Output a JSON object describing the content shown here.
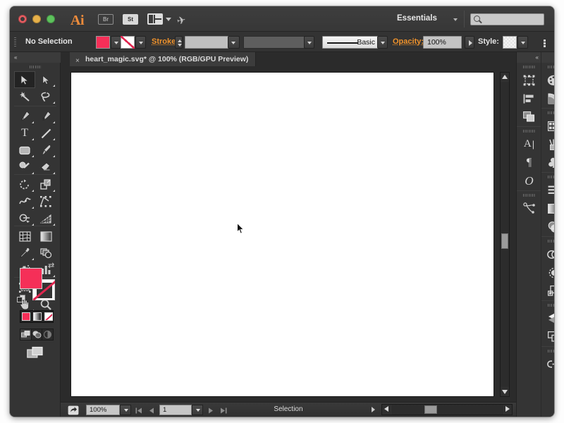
{
  "app": {
    "name": "Adobe Illustrator",
    "logo_text": "Ai",
    "bridge_label": "Br",
    "stock_label": "St",
    "workspace": "Essentials",
    "search_placeholder": ""
  },
  "titlebar": {
    "close_tooltip": "Close",
    "minimize_tooltip": "Minimize",
    "zoom_tooltip": "Zoom"
  },
  "control_bar": {
    "selection_state": "No Selection",
    "fill_color": "#f52f58",
    "stroke_color": "none",
    "stroke_label": "Stroke:",
    "stroke_weight": "",
    "stroke_profile": "",
    "brush_definition": "Basic",
    "opacity_label": "Opacity:",
    "opacity_value": "100%",
    "style_label": "Style:",
    "menu_tooltip": "Panel Menu"
  },
  "document_tab": {
    "title": "heart_magic.svg* @ 100% (RGB/GPU Preview)",
    "close_glyph": "×"
  },
  "toolbar": {
    "collapse_glyph": "«",
    "tools": [
      {
        "name": "selection-tool",
        "label": "Selection",
        "selected": true,
        "has_flyout": false
      },
      {
        "name": "direct-selection-tool",
        "label": "Direct Selection",
        "selected": false,
        "has_flyout": true
      },
      {
        "name": "magic-wand-tool",
        "label": "Magic Wand",
        "selected": false,
        "has_flyout": false
      },
      {
        "name": "lasso-tool",
        "label": "Lasso",
        "selected": false,
        "has_flyout": false
      },
      {
        "name": "pen-tool",
        "label": "Pen",
        "selected": false,
        "has_flyout": true
      },
      {
        "name": "curvature-tool",
        "label": "Curvature",
        "selected": false,
        "has_flyout": false
      },
      {
        "name": "type-tool",
        "label": "Type",
        "selected": false,
        "has_flyout": true
      },
      {
        "name": "line-segment-tool",
        "label": "Line Segment",
        "selected": false,
        "has_flyout": true
      },
      {
        "name": "rectangle-tool",
        "label": "Rectangle",
        "selected": false,
        "has_flyout": true
      },
      {
        "name": "paintbrush-tool",
        "label": "Paintbrush",
        "selected": false,
        "has_flyout": true
      },
      {
        "name": "shaper-tool",
        "label": "Shaper",
        "selected": false,
        "has_flyout": true
      },
      {
        "name": "eraser-tool",
        "label": "Eraser",
        "selected": false,
        "has_flyout": true
      },
      {
        "name": "rotate-tool",
        "label": "Rotate",
        "selected": false,
        "has_flyout": true
      },
      {
        "name": "scale-tool",
        "label": "Scale",
        "selected": false,
        "has_flyout": true
      },
      {
        "name": "width-tool",
        "label": "Width",
        "selected": false,
        "has_flyout": true
      },
      {
        "name": "free-transform-tool",
        "label": "Free Transform",
        "selected": false,
        "has_flyout": false
      },
      {
        "name": "shape-builder-tool",
        "label": "Shape Builder",
        "selected": false,
        "has_flyout": true
      },
      {
        "name": "perspective-grid-tool",
        "label": "Perspective Grid",
        "selected": false,
        "has_flyout": true
      },
      {
        "name": "mesh-tool",
        "label": "Mesh",
        "selected": false,
        "has_flyout": false
      },
      {
        "name": "gradient-tool",
        "label": "Gradient",
        "selected": false,
        "has_flyout": false
      },
      {
        "name": "eyedropper-tool",
        "label": "Eyedropper",
        "selected": false,
        "has_flyout": true
      },
      {
        "name": "blend-tool",
        "label": "Blend",
        "selected": false,
        "has_flyout": false
      },
      {
        "name": "symbol-sprayer-tool",
        "label": "Symbol Sprayer",
        "selected": false,
        "has_flyout": true
      },
      {
        "name": "column-graph-tool",
        "label": "Column Graph",
        "selected": false,
        "has_flyout": true
      },
      {
        "name": "artboard-tool",
        "label": "Artboard",
        "selected": false,
        "has_flyout": false
      },
      {
        "name": "slice-tool",
        "label": "Slice",
        "selected": false,
        "has_flyout": true
      },
      {
        "name": "hand-tool",
        "label": "Hand",
        "selected": false,
        "has_flyout": true
      },
      {
        "name": "zoom-tool",
        "label": "Zoom",
        "selected": false,
        "has_flyout": false
      }
    ],
    "fill_stroke": {
      "fill_color": "#f52f58",
      "stroke_color": "none",
      "swap_tooltip": "Swap Fill and Stroke",
      "default_tooltip": "Default Fill and Stroke"
    },
    "fill_modes": [
      {
        "name": "color-mode",
        "label": "Color",
        "active": true
      },
      {
        "name": "gradient-mode",
        "label": "Gradient",
        "active": false
      },
      {
        "name": "none-mode",
        "label": "None",
        "active": false
      }
    ],
    "draw_modes": [
      {
        "name": "draw-normal-mode",
        "label": "Draw Normal",
        "active": true
      },
      {
        "name": "draw-behind-mode",
        "label": "Draw Behind",
        "active": false
      },
      {
        "name": "draw-inside-mode",
        "label": "Draw Inside",
        "active": false
      }
    ],
    "screen_mode": {
      "name": "change-screen-mode",
      "label": "Change Screen Mode"
    }
  },
  "right_dock_a": {
    "collapse_glyph": "«",
    "panels": [
      {
        "name": "transform-panel",
        "label": "Transform"
      },
      {
        "name": "align-panel",
        "label": "Align"
      },
      {
        "name": "pathfinder-panel",
        "label": "Pathfinder"
      },
      {
        "name": "character-panel",
        "label": "Character"
      },
      {
        "name": "paragraph-panel",
        "label": "Paragraph"
      },
      {
        "name": "opentype-panel",
        "label": "OpenType"
      },
      {
        "name": "image-trace-panel",
        "label": "Image Trace"
      }
    ]
  },
  "right_dock_b": {
    "collapse_glyph": "«",
    "panels": [
      {
        "name": "color-panel",
        "label": "Color"
      },
      {
        "name": "color-guide-panel",
        "label": "Color Guide"
      },
      {
        "name": "swatches-panel",
        "label": "Swatches"
      },
      {
        "name": "brushes-panel",
        "label": "Brushes"
      },
      {
        "name": "symbols-panel",
        "label": "Symbols"
      },
      {
        "name": "stroke-panel",
        "label": "Stroke"
      },
      {
        "name": "gradient-panel",
        "label": "Gradient"
      },
      {
        "name": "transparency-panel",
        "label": "Transparency"
      },
      {
        "name": "appearance-panel",
        "label": "Appearance"
      },
      {
        "name": "graphic-styles-panel",
        "label": "Graphic Styles"
      },
      {
        "name": "artboards-panel",
        "label": "Artboards"
      },
      {
        "name": "layers-panel",
        "label": "Layers"
      },
      {
        "name": "artboards2-panel",
        "label": "Artboards"
      },
      {
        "name": "links-panel",
        "label": "Links"
      }
    ]
  },
  "status_bar": {
    "export_tooltip": "Export",
    "zoom_level": "100%",
    "page_number": "1",
    "status_text": "Selection",
    "first_glyph": "⏮",
    "prev_glyph": "◀",
    "next_glyph": "▶",
    "last_glyph": "⏭"
  },
  "canvas": {
    "background_color": "#2b2b2b",
    "artboard_color": "#ffffff",
    "cursor": "arrow-cursor"
  }
}
